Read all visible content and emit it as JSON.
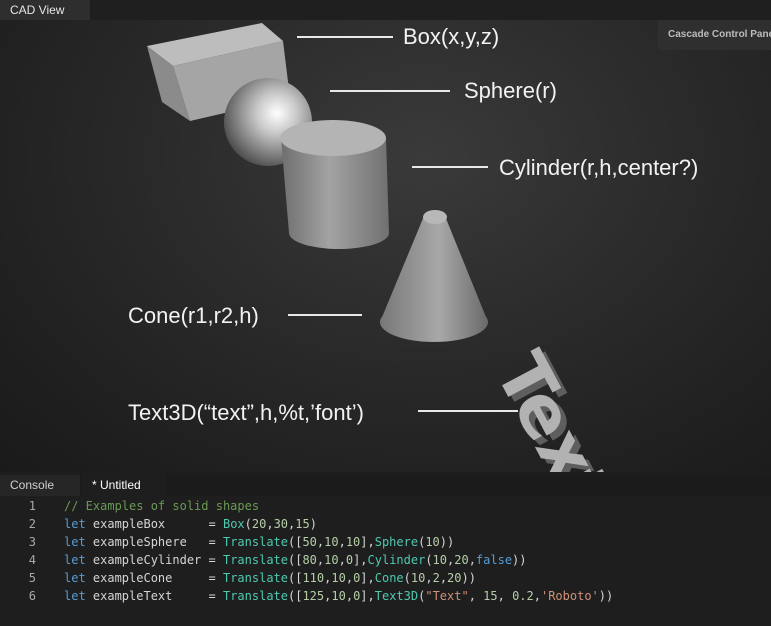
{
  "cad_tab": {
    "label": "CAD View"
  },
  "control_panel": {
    "label": "Cascade Control Panel"
  },
  "shape_labels": {
    "box": "Box(x,y,z)",
    "sphere": "Sphere(r)",
    "cylinder": "Cylinder(r,h,center?)",
    "cone": "Cone(r1,r2,h)",
    "text3d": "Text3D(“text”,h,%t,’font’)"
  },
  "extruded_text": "Text",
  "editor_tabs": {
    "console": "Console",
    "untitled": "* Untitled"
  },
  "code_lines": [
    {
      "n": "1",
      "tokens": [
        {
          "t": "// Examples of solid shapes",
          "c": "cm"
        }
      ]
    },
    {
      "n": "2",
      "tokens": [
        {
          "t": "let",
          "c": "kw"
        },
        {
          "t": " exampleBox      = ",
          "c": ""
        },
        {
          "t": "Box",
          "c": "fn"
        },
        {
          "t": "(",
          "c": ""
        },
        {
          "t": "20",
          "c": "num"
        },
        {
          "t": ",",
          "c": ""
        },
        {
          "t": "30",
          "c": "num"
        },
        {
          "t": ",",
          "c": ""
        },
        {
          "t": "15",
          "c": "num"
        },
        {
          "t": ")",
          "c": ""
        }
      ]
    },
    {
      "n": "3",
      "tokens": [
        {
          "t": "let",
          "c": "kw"
        },
        {
          "t": " exampleSphere   = ",
          "c": ""
        },
        {
          "t": "Translate",
          "c": "fn"
        },
        {
          "t": "([",
          "c": ""
        },
        {
          "t": "50",
          "c": "num"
        },
        {
          "t": ",",
          "c": ""
        },
        {
          "t": "10",
          "c": "num"
        },
        {
          "t": ",",
          "c": ""
        },
        {
          "t": "10",
          "c": "num"
        },
        {
          "t": "],",
          "c": ""
        },
        {
          "t": "Sphere",
          "c": "fn"
        },
        {
          "t": "(",
          "c": ""
        },
        {
          "t": "10",
          "c": "num"
        },
        {
          "t": "))",
          "c": ""
        }
      ]
    },
    {
      "n": "4",
      "tokens": [
        {
          "t": "let",
          "c": "kw"
        },
        {
          "t": " exampleCylinder = ",
          "c": ""
        },
        {
          "t": "Translate",
          "c": "fn"
        },
        {
          "t": "([",
          "c": ""
        },
        {
          "t": "80",
          "c": "num"
        },
        {
          "t": ",",
          "c": ""
        },
        {
          "t": "10",
          "c": "num"
        },
        {
          "t": ",",
          "c": ""
        },
        {
          "t": "0",
          "c": "num"
        },
        {
          "t": "],",
          "c": ""
        },
        {
          "t": "Cylinder",
          "c": "fn"
        },
        {
          "t": "(",
          "c": ""
        },
        {
          "t": "10",
          "c": "num"
        },
        {
          "t": ",",
          "c": ""
        },
        {
          "t": "20",
          "c": "num"
        },
        {
          "t": ",",
          "c": ""
        },
        {
          "t": "false",
          "c": "kw"
        },
        {
          "t": "))",
          "c": ""
        }
      ]
    },
    {
      "n": "5",
      "tokens": [
        {
          "t": "let",
          "c": "kw"
        },
        {
          "t": " exampleCone     = ",
          "c": ""
        },
        {
          "t": "Translate",
          "c": "fn"
        },
        {
          "t": "([",
          "c": ""
        },
        {
          "t": "110",
          "c": "num"
        },
        {
          "t": ",",
          "c": ""
        },
        {
          "t": "10",
          "c": "num"
        },
        {
          "t": ",",
          "c": ""
        },
        {
          "t": "0",
          "c": "num"
        },
        {
          "t": "],",
          "c": ""
        },
        {
          "t": "Cone",
          "c": "fn"
        },
        {
          "t": "(",
          "c": ""
        },
        {
          "t": "10",
          "c": "num"
        },
        {
          "t": ",",
          "c": ""
        },
        {
          "t": "2",
          "c": "num"
        },
        {
          "t": ",",
          "c": ""
        },
        {
          "t": "20",
          "c": "num"
        },
        {
          "t": "))",
          "c": ""
        }
      ]
    },
    {
      "n": "6",
      "tokens": [
        {
          "t": "let",
          "c": "kw"
        },
        {
          "t": " exampleText     = ",
          "c": ""
        },
        {
          "t": "Translate",
          "c": "fn"
        },
        {
          "t": "([",
          "c": ""
        },
        {
          "t": "125",
          "c": "num"
        },
        {
          "t": ",",
          "c": ""
        },
        {
          "t": "10",
          "c": "num"
        },
        {
          "t": ",",
          "c": ""
        },
        {
          "t": "0",
          "c": "num"
        },
        {
          "t": "],",
          "c": ""
        },
        {
          "t": "Text3D",
          "c": "fn"
        },
        {
          "t": "(",
          "c": ""
        },
        {
          "t": "\"Text\"",
          "c": "str"
        },
        {
          "t": ", ",
          "c": ""
        },
        {
          "t": "15",
          "c": "num"
        },
        {
          "t": ", ",
          "c": ""
        },
        {
          "t": "0.2",
          "c": "num"
        },
        {
          "t": ",",
          "c": ""
        },
        {
          "t": "'Roboto'",
          "c": "str"
        },
        {
          "t": "))",
          "c": ""
        }
      ]
    }
  ]
}
